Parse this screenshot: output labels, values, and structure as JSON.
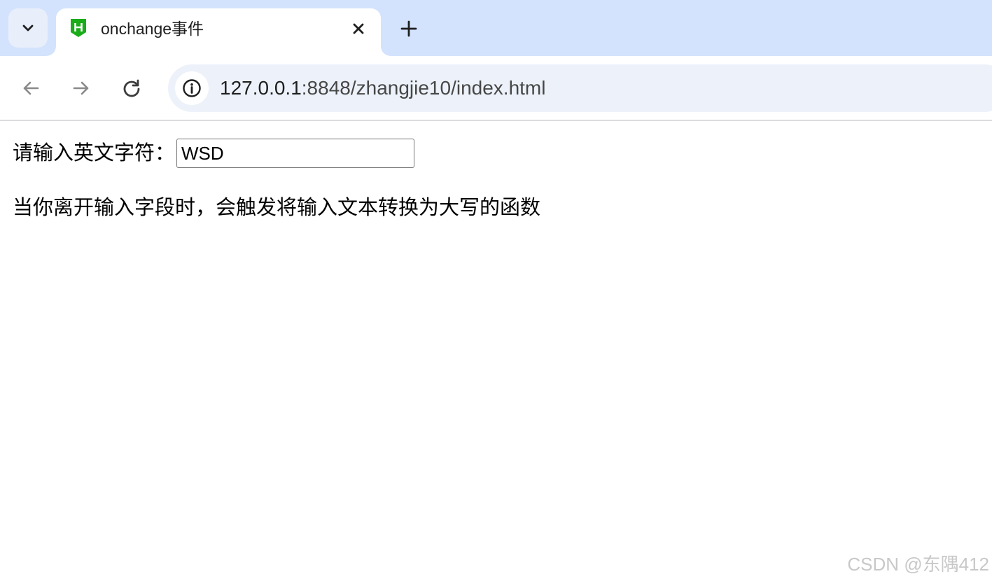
{
  "tab": {
    "title": "onchange事件",
    "favicon": "hbuilder-icon",
    "favicon_color": "#1aad19"
  },
  "toolbar": {
    "url_host": "127.0.0.1",
    "url_path": ":8848/zhangjie10/index.html"
  },
  "icons": {
    "tab_search": "chevron-down-icon",
    "close": "close-icon",
    "new_tab": "plus-icon",
    "back": "back-arrow-icon",
    "forward": "forward-arrow-icon",
    "reload": "reload-icon",
    "site_info": "info-icon"
  },
  "page": {
    "field_label": "请输入英文字符：",
    "field_value": "WSD",
    "description": "当你离开输入字段时，会触发将输入文本转换为大写的函数"
  },
  "watermark": "CSDN @东隅412",
  "colors": {
    "tabstrip_bg": "#d3e3fd",
    "omnibox_bg": "#edf2fa",
    "page_bg": "#ffffff"
  }
}
